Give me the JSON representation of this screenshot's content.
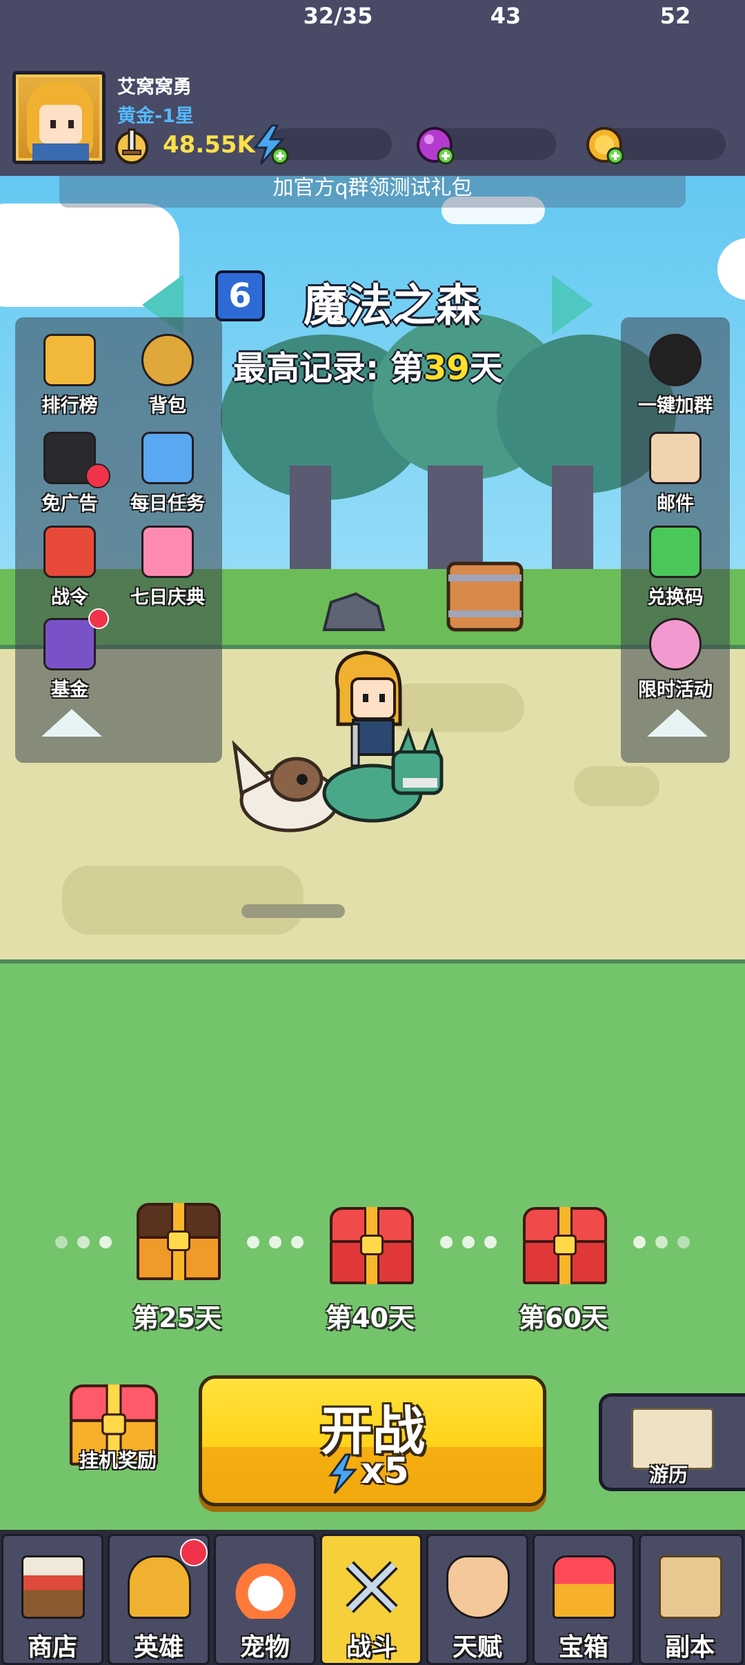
{
  "player": {
    "name": "艾窝窝勇",
    "rank": "黄金-1星",
    "power": "48.55K"
  },
  "resources": {
    "energy": "32/35",
    "gems": "43",
    "coins": "52"
  },
  "banner_text": "加官方q群领测试礼包",
  "stage": {
    "number": "6",
    "name": "魔法之森",
    "record_prefix": "最高记录: 第",
    "record_day": "39",
    "record_suffix": "天"
  },
  "left_menu": [
    {
      "label": "排行榜",
      "icon": "leaderboard-icon"
    },
    {
      "label": "背包",
      "icon": "backpack-icon"
    },
    {
      "label": "免广告",
      "icon": "no-ads-icon"
    },
    {
      "label": "每日任务",
      "icon": "daily-quest-icon"
    },
    {
      "label": "战令",
      "icon": "battle-pass-icon"
    },
    {
      "label": "七日庆典",
      "icon": "seven-day-gift-icon"
    },
    {
      "label": "基金",
      "icon": "fund-safe-icon"
    }
  ],
  "right_menu": [
    {
      "label": "一键加群",
      "icon": "qq-penguin-icon"
    },
    {
      "label": "邮件",
      "icon": "mail-scroll-icon"
    },
    {
      "label": "兑换码",
      "icon": "redeem-code-icon"
    },
    {
      "label": "限时活动",
      "icon": "gacha-machine-icon"
    }
  ],
  "milestones": [
    {
      "label": "第25天",
      "state": "opened"
    },
    {
      "label": "第40天",
      "state": "closed"
    },
    {
      "label": "第60天",
      "state": "closed"
    }
  ],
  "actions": {
    "idle_reward_label": "挂机奖励",
    "start_label": "开战",
    "start_cost": "x5",
    "travel_label": "游历"
  },
  "nav": [
    {
      "label": "商店",
      "icon": "shop-icon"
    },
    {
      "label": "英雄",
      "icon": "hero-icon"
    },
    {
      "label": "宠物",
      "icon": "pet-icon"
    },
    {
      "label": "战斗",
      "icon": "crossed-swords-icon"
    },
    {
      "label": "天赋",
      "icon": "talent-icon"
    },
    {
      "label": "宝箱",
      "icon": "treasure-chest-icon"
    },
    {
      "label": "副本",
      "icon": "dungeon-map-icon"
    }
  ],
  "colors": {
    "header_bg": "#484a66",
    "accent_gold": "#ffe04a",
    "rank_blue": "#55b8ff",
    "field_green": "#74c46c",
    "start_button": "#ffd21a",
    "badge_red": "#f0334a"
  }
}
